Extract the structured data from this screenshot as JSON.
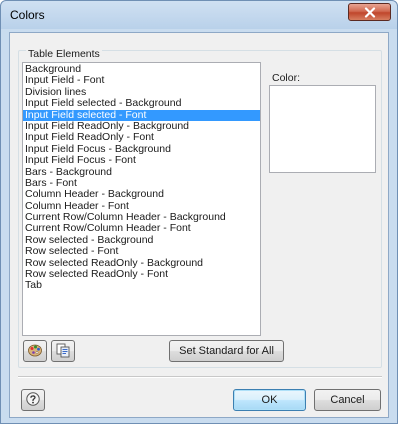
{
  "window": {
    "title": "Colors"
  },
  "group": {
    "label": "Table Elements"
  },
  "list": {
    "items": [
      "Background",
      "Input Field -  Font",
      "Division lines",
      "Input Field selected -  Background",
      "Input Field selected - Font",
      "Input Field ReadOnly - Background",
      "Input Field ReadOnly - Font",
      "Input Field Focus - Background",
      "Input Field Focus - Font",
      "Bars - Background",
      "Bars - Font",
      "Column Header - Background",
      "Column Header - Font",
      "Current Row/Column Header - Background",
      "Current Row/Column Header - Font",
      "Row selected - Background",
      "Row selected - Font",
      "Row selected  ReadOnly - Background",
      "Row selected  ReadOnly - Font",
      "Tab"
    ],
    "selected_index": 4
  },
  "color_panel": {
    "label": "Color:",
    "swatch_color": "#ffffff"
  },
  "buttons": {
    "set_standard": "Set Standard for All",
    "ok": "OK",
    "cancel": "Cancel"
  },
  "icons": {
    "close": "close-icon",
    "palette": "color-palette-icon",
    "copy": "copy-icon",
    "help": "help-icon"
  },
  "colors": {
    "selection": "#3399ff",
    "title_bar": "#b9d1ea",
    "close_button": "#c0462c"
  }
}
